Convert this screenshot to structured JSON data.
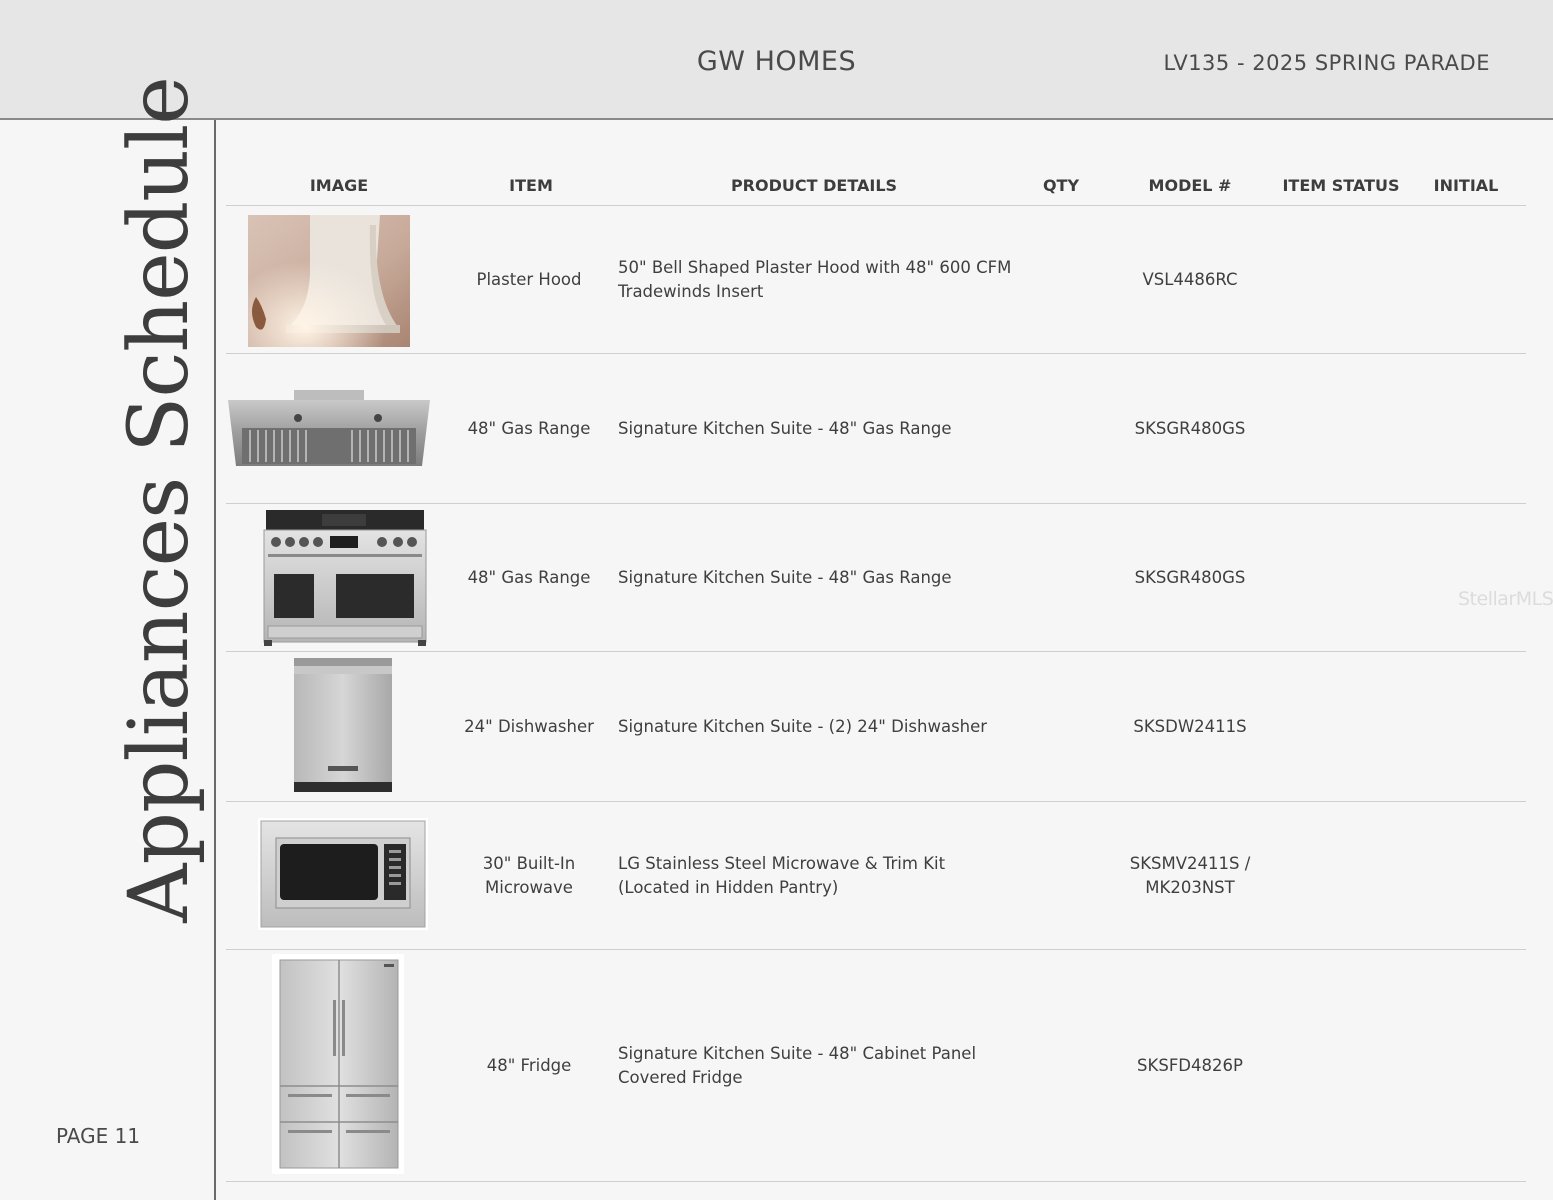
{
  "header": {
    "brand": "GW HOMES",
    "project": "LV135 - 2025 SPRING PARADE"
  },
  "sidebar": {
    "title": "Appliances Schedule",
    "page": "PAGE 11"
  },
  "table": {
    "columns": [
      "IMAGE",
      "ITEM",
      "PRODUCT DETAILS",
      "QTY",
      "MODEL #",
      "ITEM STATUS",
      "INITIAL"
    ],
    "rows": [
      {
        "image": "plaster-hood-photo",
        "item": "Plaster Hood",
        "details": "50\" Bell Shaped Plaster Hood with 48\" 600 CFM Tradewinds Insert",
        "qty": "",
        "model": "VSL4486RC",
        "status": "",
        "initial": ""
      },
      {
        "image": "hood-insert-photo",
        "item": "48\" Gas Range",
        "details": "Signature Kitchen Suite - 48\" Gas Range",
        "qty": "",
        "model": "SKSGR480GS",
        "status": "",
        "initial": ""
      },
      {
        "image": "gas-range-photo",
        "item": "48\" Gas Range",
        "details": "Signature Kitchen Suite - 48\" Gas Range",
        "qty": "",
        "model": "SKSGR480GS",
        "status": "",
        "initial": ""
      },
      {
        "image": "dishwasher-photo",
        "item": "24\" Dishwasher",
        "details": "Signature Kitchen Suite - (2)  24\" Dishwasher",
        "qty": "",
        "model": "SKSDW2411S",
        "status": "",
        "initial": ""
      },
      {
        "image": "microwave-photo",
        "item": "30\" Built-In Microwave",
        "details": "LG Stainless Steel Microwave & Trim Kit (Located in Hidden Pantry)",
        "qty": "",
        "model": "SKSMV2411S / MK203NST",
        "status": "",
        "initial": ""
      },
      {
        "image": "fridge-photo",
        "item": "48\" Fridge",
        "details": "Signature Kitchen Suite - 48\" Cabinet Panel Covered Fridge",
        "qty": "",
        "model": "SKSFD4826P",
        "status": "",
        "initial": ""
      }
    ]
  },
  "watermark": "StellarMLS"
}
